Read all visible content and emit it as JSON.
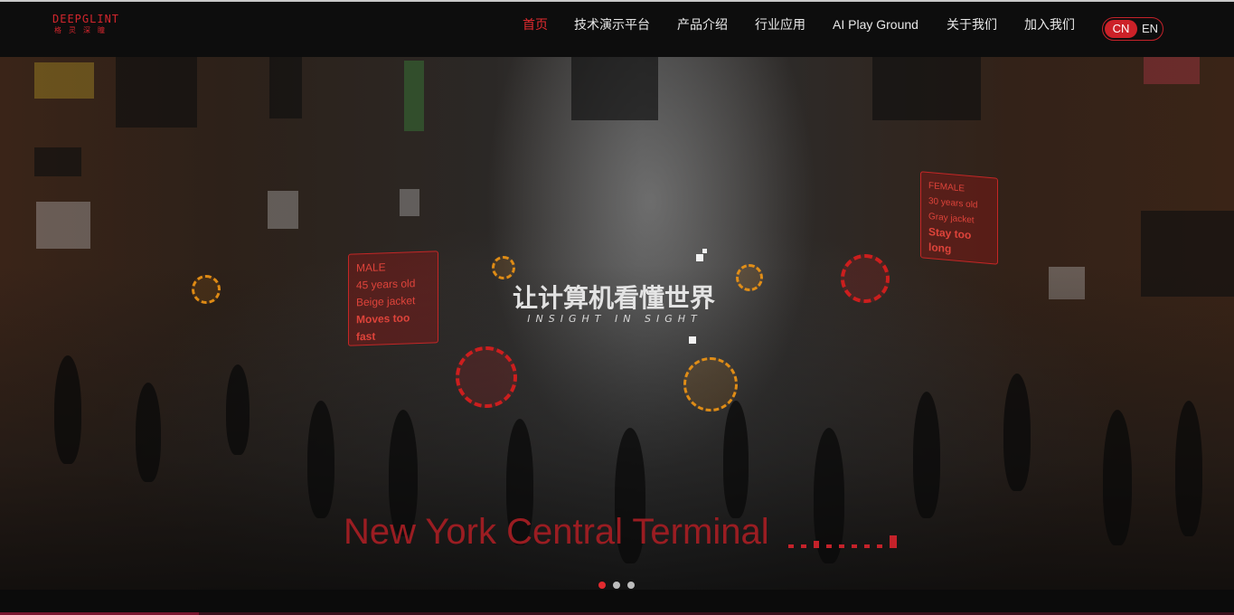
{
  "brand": {
    "logo_word": "DEEPGLINT",
    "logo_sub": "格灵深瞳"
  },
  "nav": {
    "items": [
      {
        "label": "首页",
        "active": true
      },
      {
        "label": "技术演示平台",
        "active": false
      },
      {
        "label": "产品介绍",
        "active": false
      },
      {
        "label": "行业应用",
        "active": false
      },
      {
        "label": "AI Play Ground",
        "active": false
      },
      {
        "label": "关于我们",
        "active": false
      },
      {
        "label": "加入我们",
        "active": false
      }
    ]
  },
  "lang_toggle": {
    "cn": "CN",
    "en": "EN",
    "selected": "CN"
  },
  "hero": {
    "slogan_cn": "让计算机看懂世界",
    "slogan_en": "INSIGHT IN SIGHT",
    "caption": "New York Central Terminal",
    "tags": [
      {
        "line1": "MALE",
        "line2": "45 years old",
        "line3": "Beige jacket",
        "line4": "Moves too fast"
      },
      {
        "line1": "FEMALE",
        "line2": "30 years old",
        "line3": "Gray jacket",
        "line4": "Stay too long"
      }
    ]
  },
  "carousel": {
    "total": 3,
    "active_index": 0
  },
  "colors": {
    "accent": "#e22a2f",
    "navbar_bg": "#0d0d0d"
  }
}
